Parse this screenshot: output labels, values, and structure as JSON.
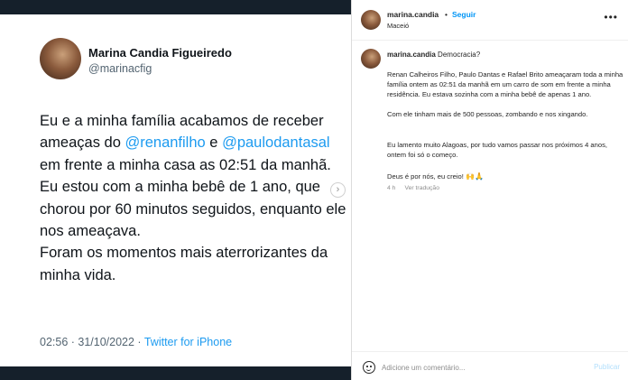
{
  "tweet": {
    "name": "Marina Candia Figueiredo",
    "handle": "@marinacfig",
    "body": [
      {
        "text": "Eu e a minha família acabamos de receber ameaças do "
      },
      {
        "mention": "@renanfilho"
      },
      {
        "text": " e "
      },
      {
        "mention": "@paulodantasal"
      },
      {
        "text": " em frente a minha casa as 02:51 da manhã."
      },
      {
        "break": true
      },
      {
        "text": "Eu estou com a minha bebê de 1 ano, que chorou por 60 minutos seguidos, enquanto ele nos ameaçava."
      },
      {
        "break": true
      },
      {
        "text": "Foram os momentos mais aterrorizantes da minha vida."
      }
    ],
    "timestamp": "02:56 · 31/10/2022 · ",
    "source": "Twitter for iPhone"
  },
  "next_arrow": "›",
  "panel": {
    "header": {
      "username": "marina.candia",
      "separator": "•",
      "follow_label": "Seguir",
      "location": "Maceió",
      "more_icon": "•••"
    },
    "caption": {
      "username": "marina.candia",
      "title": "Democracia?",
      "paragraph1": "Renan Calheiros Filho, Paulo Dantas e Rafael Brito ameaçaram toda a minha família ontem as 02:51 da manhã em um carro de som em frente a minha residência. Eu estava sozinha com a minha bebê de apenas 1 ano.",
      "paragraph2": "Com ele tinham mais de 500 pessoas, zombando e nos xingando.",
      "paragraph3": "Eu lamento muito Alagoas, por tudo vamos passar nos próximos 4 anos, ontem foi só o começo.",
      "paragraph4": "Deus é por nós, eu creio!",
      "emojis": "🙌🙏",
      "time_ago": "4 h",
      "translate_label": "Ver tradução"
    },
    "comment": {
      "placeholder": "Adicione um comentário...",
      "publish_label": "Publicar"
    }
  },
  "colors": {
    "link_blue": "#1d9bf0",
    "instagram_blue": "#0095f6",
    "publish_disabled": "#b2dffc"
  }
}
